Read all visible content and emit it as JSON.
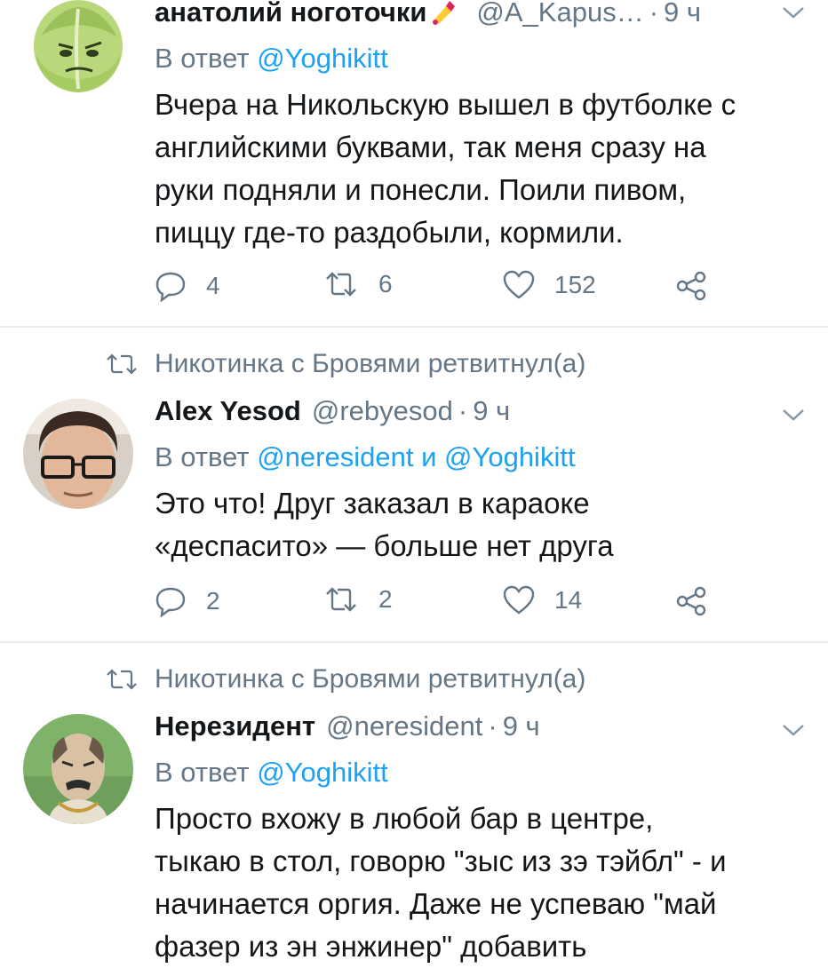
{
  "tweets": [
    {
      "author_name": "анатолий ноготочки",
      "handle": "@A_Kapus…",
      "dot": "·",
      "time": "9 ч",
      "reply_prefix": "В ответ",
      "reply_to": "@Yoghikitt",
      "reply_join": "",
      "reply_to_2": "",
      "text_lines": [
        "Вчера на Никольскую вышел в футболке с",
        "английскими буквами, так меня сразу на",
        "руки подняли и понесли. Поили пивом,",
        "пиццу где-то раздобыли, кормили."
      ],
      "counts": {
        "reply": "4",
        "retweet": "6",
        "like": "152"
      }
    },
    {
      "retweeted_by": "Никотинка с Бровями ретвитнул(а)",
      "author_name": "Alex Yesod",
      "handle": "@rebyesod",
      "dot": "·",
      "time": "9 ч",
      "reply_prefix": "В ответ",
      "reply_to": "@neresident",
      "reply_join": "и",
      "reply_to_2": "@Yoghikitt",
      "text_lines": [
        "Это что! Друг заказал в караоке",
        "«деспасито» — больше нет друга"
      ],
      "counts": {
        "reply": "2",
        "retweet": "2",
        "like": "14"
      }
    },
    {
      "retweeted_by": "Никотинка с Бровями ретвитнул(а)",
      "author_name": "Нерезидент",
      "handle": "@neresident",
      "dot": "·",
      "time": "9 ч",
      "reply_prefix": "В ответ",
      "reply_to": "@Yoghikitt",
      "reply_join": "",
      "reply_to_2": "",
      "text_lines": [
        "Просто вхожу в любой бар в центре,",
        "тыкаю в стол, говорю \"зыс из зэ тэйбл\" - и",
        "начинается оргия. Даже не успеваю \"май",
        "фазер из эн энжинер\" добавить"
      ]
    }
  ],
  "icons": {
    "reply": "reply-icon",
    "retweet": "retweet-icon",
    "like": "heart-icon",
    "share": "share-icon",
    "caret": "chevron-down-icon",
    "emoji": "nail-polish-emoji-icon"
  },
  "colors": {
    "text": "#14171a",
    "secondary": "#657786",
    "link": "#1da1f2",
    "divider": "#e6ecf0"
  }
}
